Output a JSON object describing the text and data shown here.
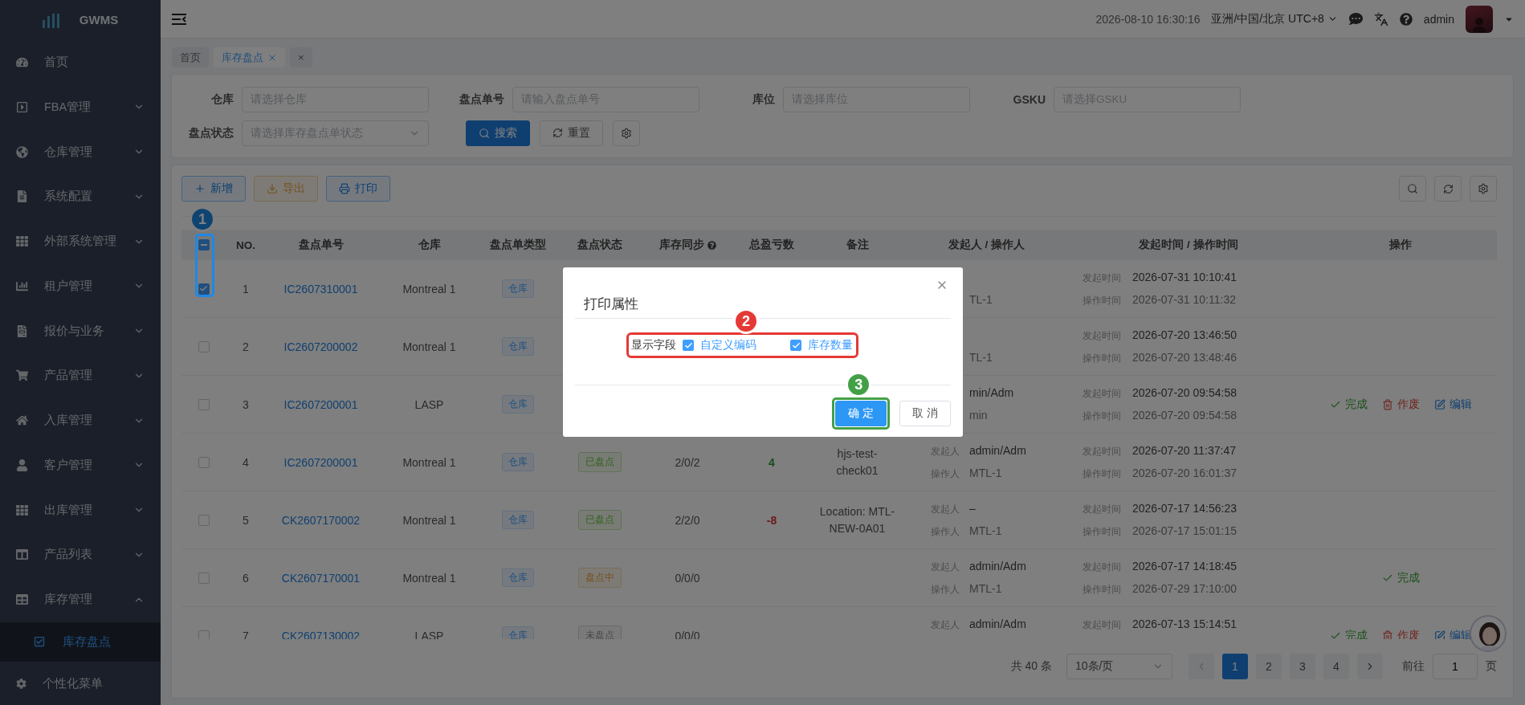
{
  "sidebar": {
    "logo": "GWMS",
    "items": [
      {
        "label": "首页",
        "kind": "link",
        "expanded": false
      },
      {
        "label": "FBA管理",
        "kind": "group",
        "expanded": false
      },
      {
        "label": "仓库管理",
        "kind": "group",
        "expanded": false
      },
      {
        "label": "系统配置",
        "kind": "group",
        "expanded": false
      },
      {
        "label": "外部系统管理",
        "kind": "group",
        "expanded": false
      },
      {
        "label": "租户管理",
        "kind": "group",
        "expanded": false
      },
      {
        "label": "报价与业务",
        "kind": "group",
        "expanded": false
      },
      {
        "label": "产品管理",
        "kind": "group",
        "expanded": false
      },
      {
        "label": "入库管理",
        "kind": "group",
        "expanded": false
      },
      {
        "label": "客户管理",
        "kind": "group",
        "expanded": false
      },
      {
        "label": "出库管理",
        "kind": "group",
        "expanded": false
      },
      {
        "label": "产品列表",
        "kind": "group",
        "expanded": false
      },
      {
        "label": "库存管理",
        "kind": "group",
        "expanded": true,
        "children": [
          {
            "label": "库存盘点",
            "selected": true
          }
        ]
      }
    ],
    "footer_item": "个性化菜单"
  },
  "header": {
    "datetime": "2026-08-10 16:30:16",
    "timezone": "亚洲/中国/北京 UTC+8",
    "user": "admin"
  },
  "tabs": [
    {
      "label": "首页",
      "selected": false,
      "closable": false
    },
    {
      "label": "库存盘点",
      "selected": true,
      "closable": true
    },
    {
      "label": "×",
      "selected": false,
      "closable": false
    }
  ],
  "filters": [
    {
      "label": "仓库",
      "placeholder": "请选择仓库",
      "kind": "input"
    },
    {
      "label": "盘点单号",
      "placeholder": "请输入盘点单号",
      "kind": "input"
    },
    {
      "label": "库位",
      "placeholder": "请选择库位",
      "kind": "input"
    },
    {
      "label": "GSKU",
      "placeholder": "请选择GSKU",
      "kind": "input"
    },
    {
      "label": "盘点状态",
      "placeholder": "请选择库存盘点单状态",
      "kind": "select"
    }
  ],
  "filter_buttons": {
    "search": "搜索",
    "reset": "重置"
  },
  "toolbar": [
    {
      "label": "新增",
      "kind": "add"
    },
    {
      "label": "导出",
      "kind": "export"
    },
    {
      "label": "打印",
      "kind": "print"
    }
  ],
  "table": {
    "select_all": {
      "indeterminate": true
    },
    "columns": [
      "NO.",
      "盘点单号",
      "仓库",
      "盘点单类型",
      "盘点状态",
      "库存同步",
      "总盈亏数",
      "备注",
      "发起人 / 操作人",
      "发起时间 / 操作时间",
      "操作"
    ],
    "rows": [
      {
        "selected": true,
        "no": "1",
        "code": "IC2607310001",
        "warehouse": "Montreal 1",
        "type": "仓库",
        "operator": {
          "value": "TL-1"
        },
        "start_time": {
          "label": "发起时间",
          "value": "2026-07-31 10:10:41"
        },
        "op_time": {
          "label": "操作时间",
          "value": "2026-07-31 10:11:32"
        }
      },
      {
        "selected": false,
        "no": "2",
        "code": "IC2607200002",
        "warehouse": "Montreal 1",
        "type": "仓库",
        "operator": {
          "value": "TL-1"
        },
        "start_time": {
          "label": "发起时间",
          "value": "2026-07-20 13:46:50"
        },
        "op_time": {
          "label": "操作时间",
          "value": "2026-07-20 13:48:46"
        }
      },
      {
        "selected": false,
        "no": "3",
        "code": "IC2607200001",
        "warehouse": "LASP",
        "type": "仓库",
        "initiator": {
          "value": "min/Adm"
        },
        "operator": {
          "value": "min"
        },
        "start_time": {
          "label": "发起时间",
          "value": "2026-07-20 09:54:58"
        },
        "op_time": {
          "label": "操作时间",
          "value": "2026-07-20 09:54:58"
        },
        "actions": [
          {
            "label": "完成",
            "kind": "complete"
          },
          {
            "label": "作废",
            "kind": "void"
          },
          {
            "label": "编辑",
            "kind": "edit"
          }
        ]
      },
      {
        "selected": false,
        "no": "4",
        "code": "IC2607200001",
        "warehouse": "Montreal 1",
        "type": "仓库",
        "status": {
          "label": "已盘点",
          "kind": "done"
        },
        "sync": "2/0/2",
        "total": {
          "value": "4",
          "kind": "gain"
        },
        "note": "hjs-test-check01",
        "initiator": {
          "label": "发起人",
          "value": "admin/Adm"
        },
        "operator": {
          "label": "操作人",
          "value": "MTL-1"
        },
        "start_time": {
          "label": "发起时间",
          "value": "2026-07-20 11:37:47"
        },
        "op_time": {
          "label": "操作时间",
          "value": "2026-07-20 16:01:37"
        }
      },
      {
        "selected": false,
        "no": "5",
        "code": "CK2607170002",
        "warehouse": "Montreal 1",
        "type": "仓库",
        "status": {
          "label": "已盘点",
          "kind": "done"
        },
        "sync": "2/2/0",
        "total": {
          "value": "-8",
          "kind": "loss"
        },
        "note": "Location: MTL-NEW-0A01",
        "initiator": {
          "label": "发起人",
          "value": "–"
        },
        "operator": {
          "label": "操作人",
          "value": "MTL-1"
        },
        "start_time": {
          "label": "发起时间",
          "value": "2026-07-17 14:56:23"
        },
        "op_time": {
          "label": "操作时间",
          "value": "2026-07-17 15:01:15"
        }
      },
      {
        "selected": false,
        "no": "6",
        "code": "CK2607170001",
        "warehouse": "Montreal 1",
        "type": "仓库",
        "status": {
          "label": "盘点中",
          "kind": "in_progress"
        },
        "sync": "0/0/0",
        "initiator": {
          "label": "发起人",
          "value": "admin/Adm"
        },
        "operator": {
          "label": "操作人",
          "value": "MTL-1"
        },
        "start_time": {
          "label": "发起时间",
          "value": "2026-07-17 14:18:45"
        },
        "op_time": {
          "label": "操作时间",
          "value": "2026-07-29 17:10:00"
        },
        "actions": [
          {
            "label": "完成",
            "kind": "complete"
          }
        ]
      },
      {
        "selected": false,
        "no": "7",
        "code": "CK2607130002",
        "warehouse": "LASP",
        "type": "仓库",
        "status": {
          "label": "未盘点",
          "kind": "not_started"
        },
        "sync": "0/0/0",
        "initiator": {
          "label": "发起人",
          "value": "admin/Adm"
        },
        "start_time": {
          "label": "发起时间",
          "value": "2026-07-13 15:14:51"
        },
        "actions": [
          {
            "label": "完成",
            "kind": "complete"
          },
          {
            "label": "作废",
            "kind": "void"
          },
          {
            "label": "编辑",
            "kind": "edit"
          }
        ]
      }
    ]
  },
  "pagination": {
    "total": "共 40 条",
    "page_size": "10条/页",
    "pages": [
      {
        "label": "1",
        "selected": true
      },
      {
        "label": "2",
        "selected": false
      },
      {
        "label": "3",
        "selected": false
      },
      {
        "label": "4",
        "selected": false
      }
    ],
    "goto_label": "前往",
    "goto_value": "1",
    "goto_suffix": "页"
  },
  "dialog": {
    "title": "打印属性",
    "field_label": "显示字段",
    "options": [
      {
        "label": "自定义编码",
        "checked": true
      },
      {
        "label": "库存数量",
        "checked": true
      }
    ],
    "confirm": "确 定",
    "cancel": "取 消"
  },
  "annotations": [
    {
      "number": "1",
      "color": "#1e88e5"
    },
    {
      "number": "2",
      "color": "#e53935"
    },
    {
      "number": "3",
      "color": "#43a047"
    }
  ]
}
